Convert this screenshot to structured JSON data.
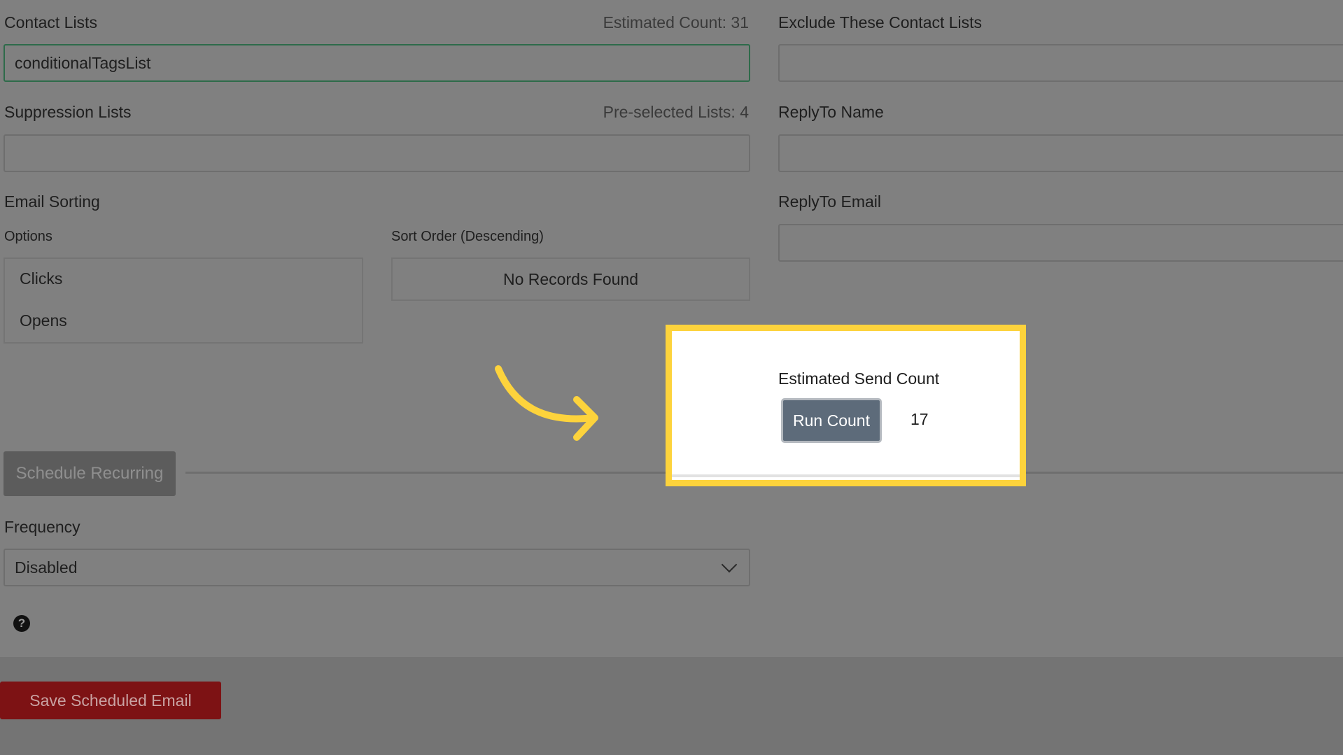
{
  "contact_lists": {
    "label": "Contact Lists",
    "estimated_count": "Estimated Count: 31",
    "value": "conditionalTagsList"
  },
  "exclude_lists": {
    "label": "Exclude These Contact Lists",
    "value": ""
  },
  "suppression_lists": {
    "label": "Suppression Lists",
    "preselected": "Pre-selected Lists: 4",
    "value": ""
  },
  "reply_to_name": {
    "label": "ReplyTo Name",
    "value": ""
  },
  "reply_to_email": {
    "label": "ReplyTo Email",
    "value": ""
  },
  "email_sorting": {
    "label": "Email Sorting",
    "options_label": "Options",
    "options": [
      "Clicks",
      "Opens"
    ],
    "sort_order_label": "Sort Order (Descending)",
    "sort_order_empty": "No Records Found"
  },
  "estimated_send": {
    "label": "Estimated Send Count",
    "button": "Run Count",
    "count": "17"
  },
  "schedule_recurring": {
    "label": "Schedule Recurring"
  },
  "frequency": {
    "label": "Frequency",
    "value": "Disabled"
  },
  "footer": {
    "save_label": "Save Scheduled Email"
  },
  "colors": {
    "highlight": "#fdd33c",
    "arrow": "#fdd33c",
    "save_button": "#7d1214",
    "run_button": "#5d6b7a"
  }
}
